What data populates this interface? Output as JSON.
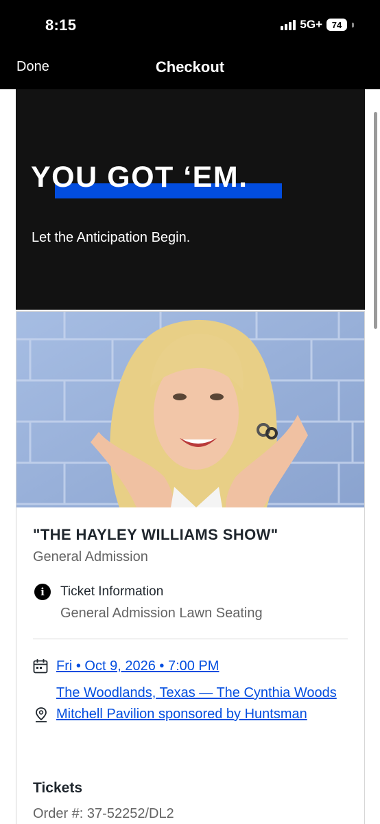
{
  "status_bar": {
    "time": "8:15",
    "network": "5G+",
    "battery": "74"
  },
  "nav": {
    "done_label": "Done",
    "title": "Checkout"
  },
  "hero": {
    "headline": "YOU GOT ‘EM.",
    "subline": "Let the Anticipation Begin.",
    "accent_color": "#024ddf"
  },
  "event": {
    "title": "\"THE HAYLEY WILLIAMS SHOW\"",
    "ticket_type": "General Admission",
    "info_label": "Ticket Information",
    "info_value": "General Admission Lawn Seating",
    "date": "Fri • Oct 9, 2026 • 7:00 PM",
    "venue": "The Woodlands, Texas — The Cynthia Woods Mitchell Pavilion sponsored by Huntsman"
  },
  "tickets": {
    "heading": "Tickets",
    "order": "Order #: 37-52252/DL2"
  },
  "icons": {
    "info": "info-icon",
    "calendar": "calendar-icon",
    "location": "location-pin-icon"
  },
  "colors": {
    "link": "#024ddf",
    "hero_bg": "#121212",
    "header_bg": "#000000"
  }
}
